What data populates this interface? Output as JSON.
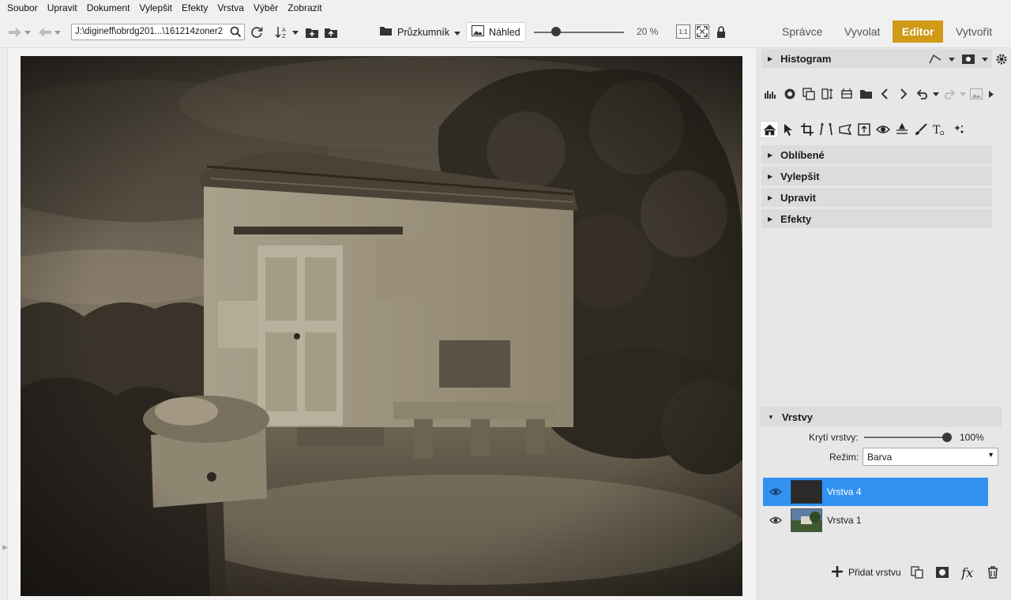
{
  "menu": [
    "Soubor",
    "Upravit",
    "Dokument",
    "Vylepšit",
    "Efekty",
    "Vrstva",
    "Výběr",
    "Zobrazit"
  ],
  "toolbar": {
    "path": "J:\\digineff\\obrdg201...\\161214zoner2",
    "explorer_label": "Průzkumník",
    "preview_label": "Náhled",
    "zoom": "20 %",
    "actual_size_label": "1:1"
  },
  "modes": [
    {
      "label": "Správce"
    },
    {
      "label": "Vyvolat"
    },
    {
      "label": "Editor"
    },
    {
      "label": "Vytvořit"
    }
  ],
  "panel": {
    "histogram": "Histogram",
    "sections": [
      "Oblíbené",
      "Vylepšit",
      "Upravit",
      "Efekty"
    ]
  },
  "layers": {
    "title": "Vrstvy",
    "opacity_label": "Krytí vrstvy:",
    "opacity_value": "100%",
    "mode_label": "Režim:",
    "mode_value": "Barva",
    "items": [
      {
        "name": "Vrstva 4"
      },
      {
        "name": "Vrstva 1"
      }
    ],
    "add_label": "Přidat vrstvu",
    "fx_label": "fx"
  },
  "colors": {
    "accent_active_mode": "#d19a17",
    "layer_selection": "#3292f2"
  }
}
